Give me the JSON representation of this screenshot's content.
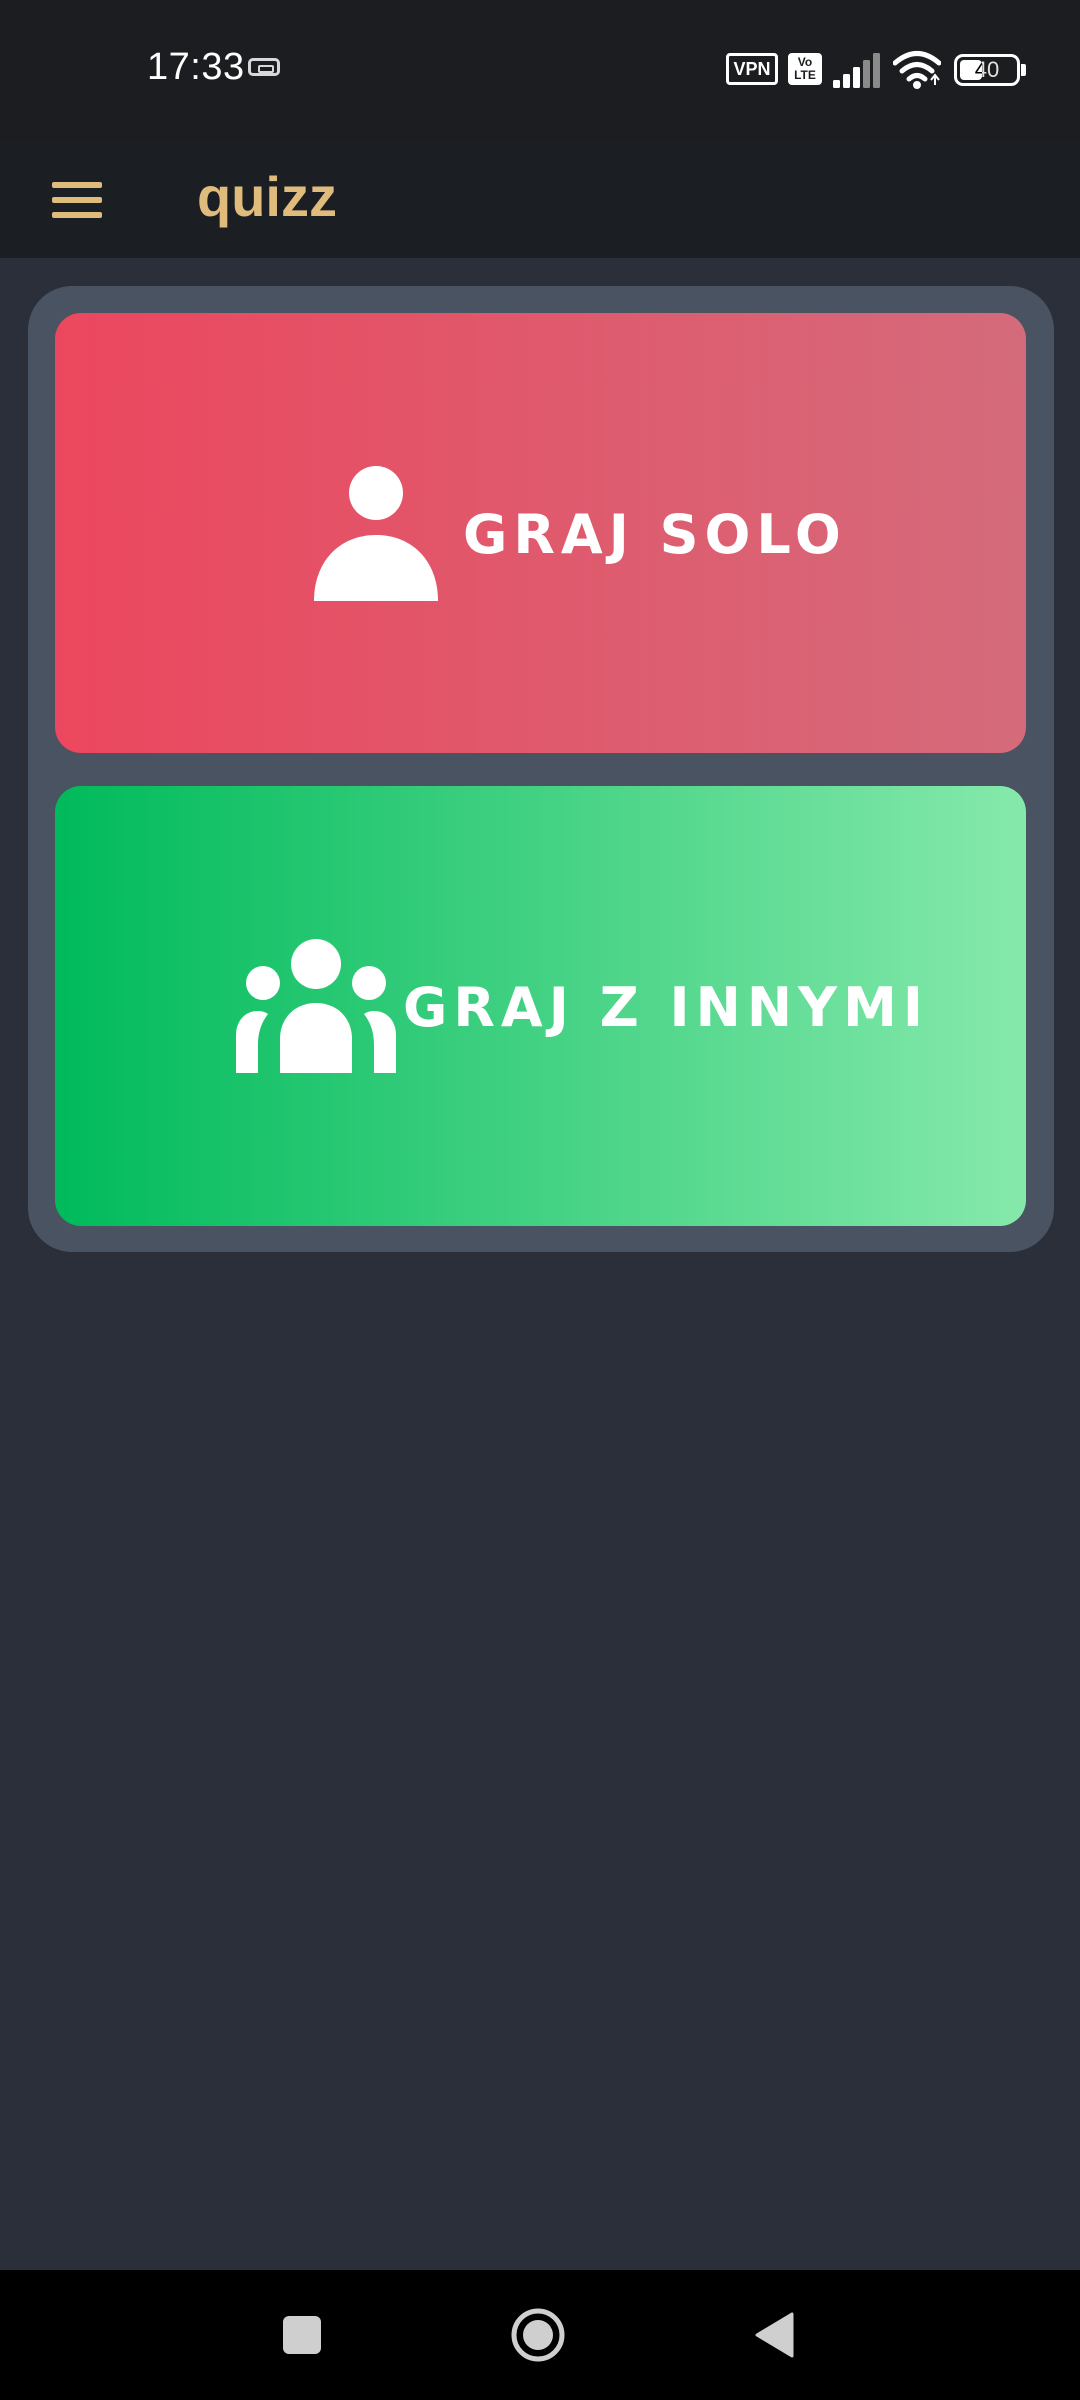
{
  "status_bar": {
    "time": "17:33",
    "vpn_label": "VPN",
    "volte_label": "Vo\nLTE",
    "battery_level": "40",
    "icons": [
      "sim-icon",
      "vpn-icon",
      "volte-icon",
      "signal-icon",
      "wifi-icon",
      "battery-icon"
    ]
  },
  "app_bar": {
    "title": "quizz",
    "menu_icon": "hamburger-menu-icon",
    "accent_color": "#e0bc7c"
  },
  "modes": [
    {
      "label": "GRAJ SOLO",
      "icon": "person-icon",
      "gradient": [
        "#ec475e",
        "#d46b7b"
      ]
    },
    {
      "label": "GRAJ Z INNYMI",
      "icon": "group-icon",
      "gradient": [
        "#00ba5b",
        "#86e9ac"
      ]
    }
  ],
  "nav_bar": {
    "buttons": [
      "recents-button",
      "home-button",
      "back-button"
    ]
  }
}
